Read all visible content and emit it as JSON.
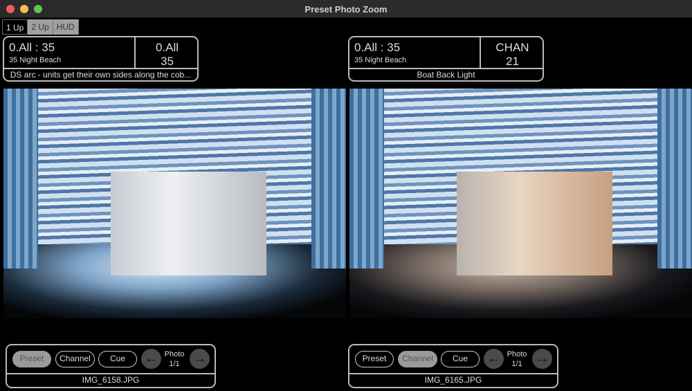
{
  "window": {
    "title": "Preset Photo Zoom"
  },
  "tabs": [
    {
      "label": "1 Up",
      "active": true
    },
    {
      "label": "2 Up"
    },
    {
      "label": "HUD"
    }
  ],
  "panels": [
    {
      "target": "0.All : 35",
      "label": "35 Night Beach",
      "right_top": "0.All",
      "right_bottom": "35",
      "note": "DS arc - units get their own sides along the cob...",
      "buttons": {
        "preset": "Preset",
        "channel": "Channel",
        "cue": "Cue",
        "selected": "preset"
      },
      "photo_label": "Photo",
      "photo_count": "1/1",
      "filename": "IMG_6158.JPG"
    },
    {
      "target": "0.All : 35",
      "label": "35 Night Beach",
      "right_top": "CHAN",
      "right_bottom": "21",
      "note": "Boat Back Light",
      "buttons": {
        "preset": "Preset",
        "channel": "Channel",
        "cue": "Cue",
        "selected": "channel"
      },
      "photo_label": "Photo",
      "photo_count": "1/1",
      "filename": "IMG_6165.JPG"
    }
  ]
}
